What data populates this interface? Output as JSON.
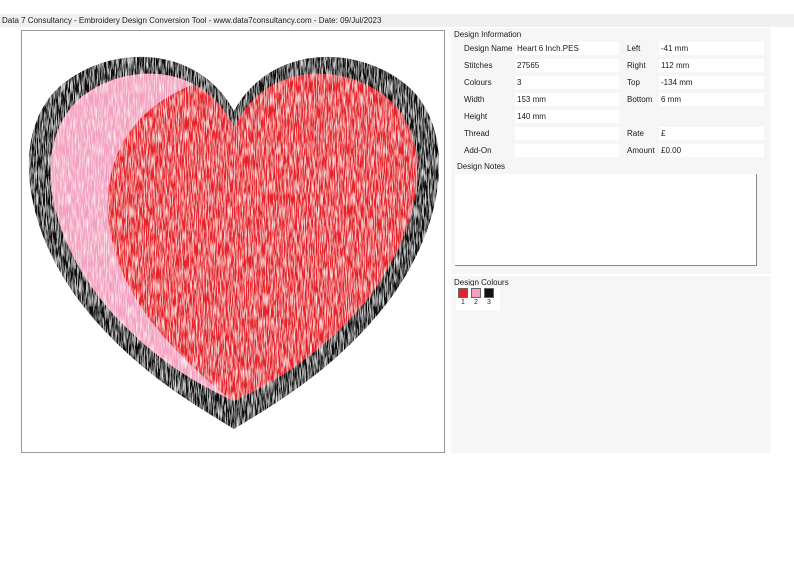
{
  "window": {
    "title": "Data 7 Consultancy - Embroidery Design Conversion Tool - www.data7consultancy.com - Date: 09/Jul/2023"
  },
  "info": {
    "section_title": "Design Information",
    "labels": {
      "design_name": "Design Name",
      "stitches": "Stitches",
      "colours": "Colours",
      "width": "Width",
      "height": "Height",
      "thread": "Thread",
      "addon": "Add-On",
      "left": "Left",
      "right": "Right",
      "top": "Top",
      "bottom": "Bottom",
      "rate": "Rate",
      "amount": "Amount"
    },
    "values": {
      "design_name": "Heart 6 Inch.PES",
      "stitches": "27565",
      "colours": "3",
      "width": "153 mm",
      "height": "140 mm",
      "thread": "",
      "addon": "",
      "left": "-41 mm",
      "right": "112 mm",
      "top": "-134 mm",
      "bottom": "6 mm",
      "rate": "£",
      "amount": "£0.00"
    },
    "notes_label": "Design Notes",
    "notes": ""
  },
  "colours": {
    "section_title": "Design Colours",
    "swatches": [
      {
        "number": "1",
        "color": "#e8202a"
      },
      {
        "number": "2",
        "color": "#f4a0c0"
      },
      {
        "number": "3",
        "color": "#111111"
      }
    ]
  },
  "preview": {
    "outline_color": "#111111",
    "fill_color": "#e8202a",
    "highlight_color": "#f4a0c0"
  }
}
